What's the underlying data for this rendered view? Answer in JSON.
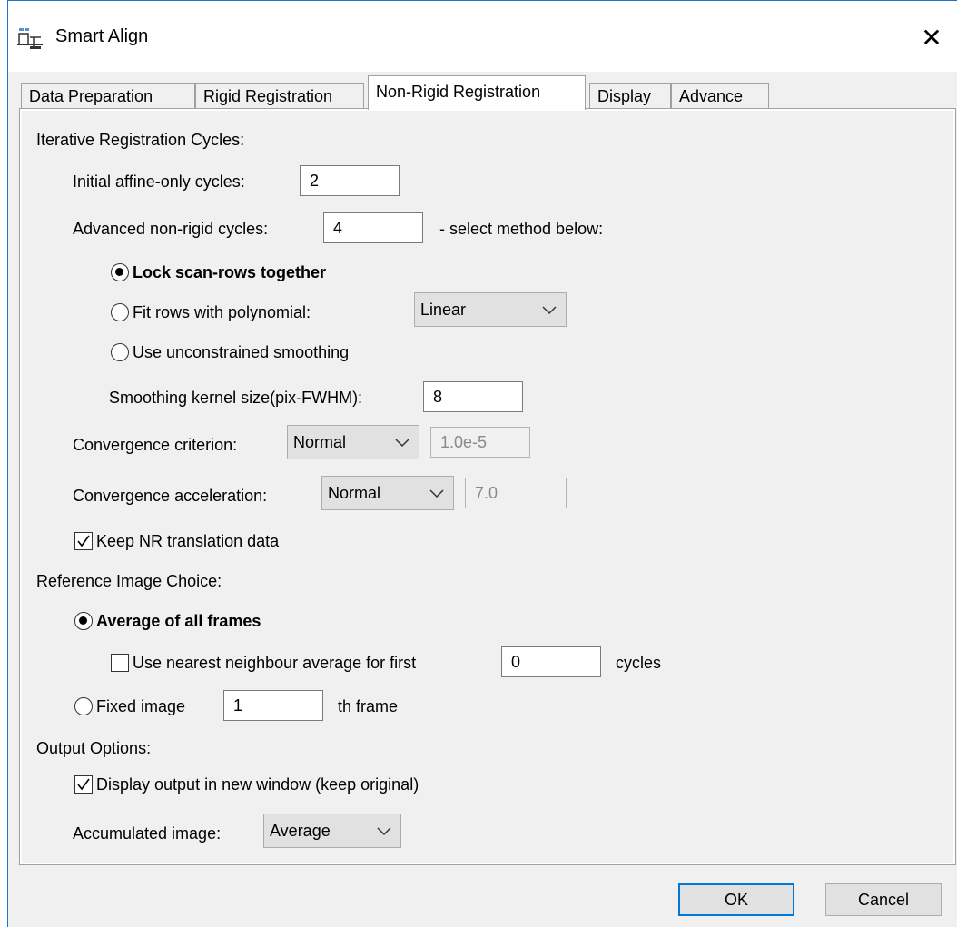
{
  "window": {
    "title": "Smart Align",
    "close_label": "✕"
  },
  "tabs": [
    {
      "label": "Data Preparation",
      "active": false
    },
    {
      "label": "Rigid Registration",
      "active": false
    },
    {
      "label": "Non-Rigid Registration",
      "active": true
    },
    {
      "label": "Display",
      "active": false
    },
    {
      "label": "Advance",
      "active": false
    }
  ],
  "iterative": {
    "heading": "Iterative Registration Cycles:",
    "affine_label": "Initial affine-only cycles:",
    "affine_value": "2",
    "nonrigid_label": "Advanced non-rigid cycles:",
    "nonrigid_value": "4",
    "nonrigid_hint": "- select method below:",
    "method_lock": "Lock scan-rows together",
    "method_poly": "Fit rows with polynomial:",
    "poly_select": "Linear",
    "method_unconstrained": "Use unconstrained smoothing",
    "kernel_label": "Smoothing kernel size(pix-FWHM):",
    "kernel_value": "8",
    "criterion_label": "Convergence criterion:",
    "criterion_select": "Normal",
    "criterion_value": "1.0e-5",
    "accel_label": "Convergence acceleration:",
    "accel_select": "Normal",
    "accel_value": "7.0",
    "keep_nr_label": "Keep NR translation data",
    "keep_nr_checked": true,
    "selected_method": "lock"
  },
  "reference": {
    "heading": "Reference Image Choice:",
    "average_label": "Average of all frames",
    "nearest_label": "Use nearest neighbour average for first",
    "nearest_value": "0",
    "nearest_suffix": "cycles",
    "nearest_checked": false,
    "fixed_label": "Fixed image",
    "fixed_value": "1",
    "fixed_suffix": "th frame",
    "selected": "average"
  },
  "output": {
    "heading": "Output Options:",
    "display_new_label": "Display output in new window (keep original)",
    "display_new_checked": true,
    "accumulated_label": "Accumulated image:",
    "accumulated_select": "Average"
  },
  "buttons": {
    "ok": "OK",
    "cancel": "Cancel"
  }
}
